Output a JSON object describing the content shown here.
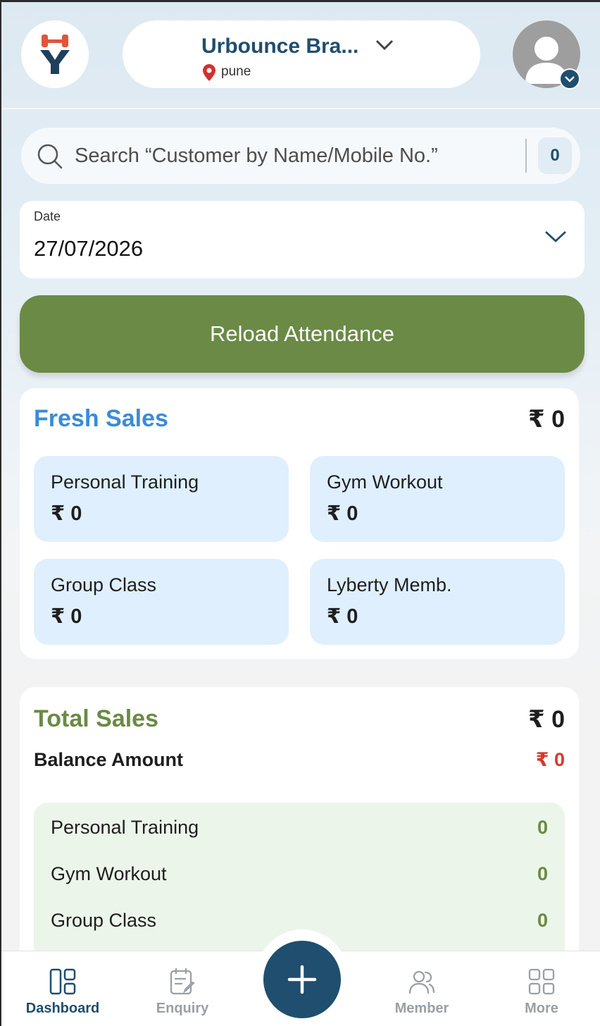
{
  "header": {
    "branch_name": "Urbounce Bra...",
    "location": "pune"
  },
  "search": {
    "placeholder": "Search “Customer by Name/Mobile No.”",
    "count": "0"
  },
  "date": {
    "label": "Date",
    "value": "27/07/2026"
  },
  "reload_label": "Reload Attendance",
  "fresh_sales": {
    "title": "Fresh Sales",
    "total": "₹ 0",
    "title_color": "#3a8bd8",
    "tiles": [
      {
        "label": "Personal Training",
        "value": "₹ 0"
      },
      {
        "label": "Gym Workout",
        "value": "₹ 0"
      },
      {
        "label": "Group Class",
        "value": "₹ 0"
      },
      {
        "label": "Lyberty Memb.",
        "value": "₹ 0"
      }
    ]
  },
  "total_sales": {
    "title": "Total Sales",
    "total": "₹ 0",
    "title_color": "#6a8a45",
    "balance_label": "Balance Amount",
    "balance_value": "₹ 0",
    "rows": [
      {
        "label": "Personal Training",
        "value": "0"
      },
      {
        "label": "Gym Workout",
        "value": "0"
      },
      {
        "label": "Group Class",
        "value": "0"
      }
    ]
  },
  "nav": {
    "items": [
      {
        "label": "Dashboard",
        "icon": "dashboard-icon",
        "active": true
      },
      {
        "label": "Enquiry",
        "icon": "enquiry-icon",
        "active": false
      },
      {
        "label": "Member",
        "icon": "member-icon",
        "active": false
      },
      {
        "label": "More",
        "icon": "more-icon",
        "active": false
      }
    ],
    "fab_icon": "plus-icon"
  },
  "colors": {
    "primary": "#1f4e6f",
    "reload_button": "#6a8a45",
    "tile_background": "#dfeffd",
    "breakdown_background": "#ecf5ea",
    "balance_value": "#d6392c"
  }
}
